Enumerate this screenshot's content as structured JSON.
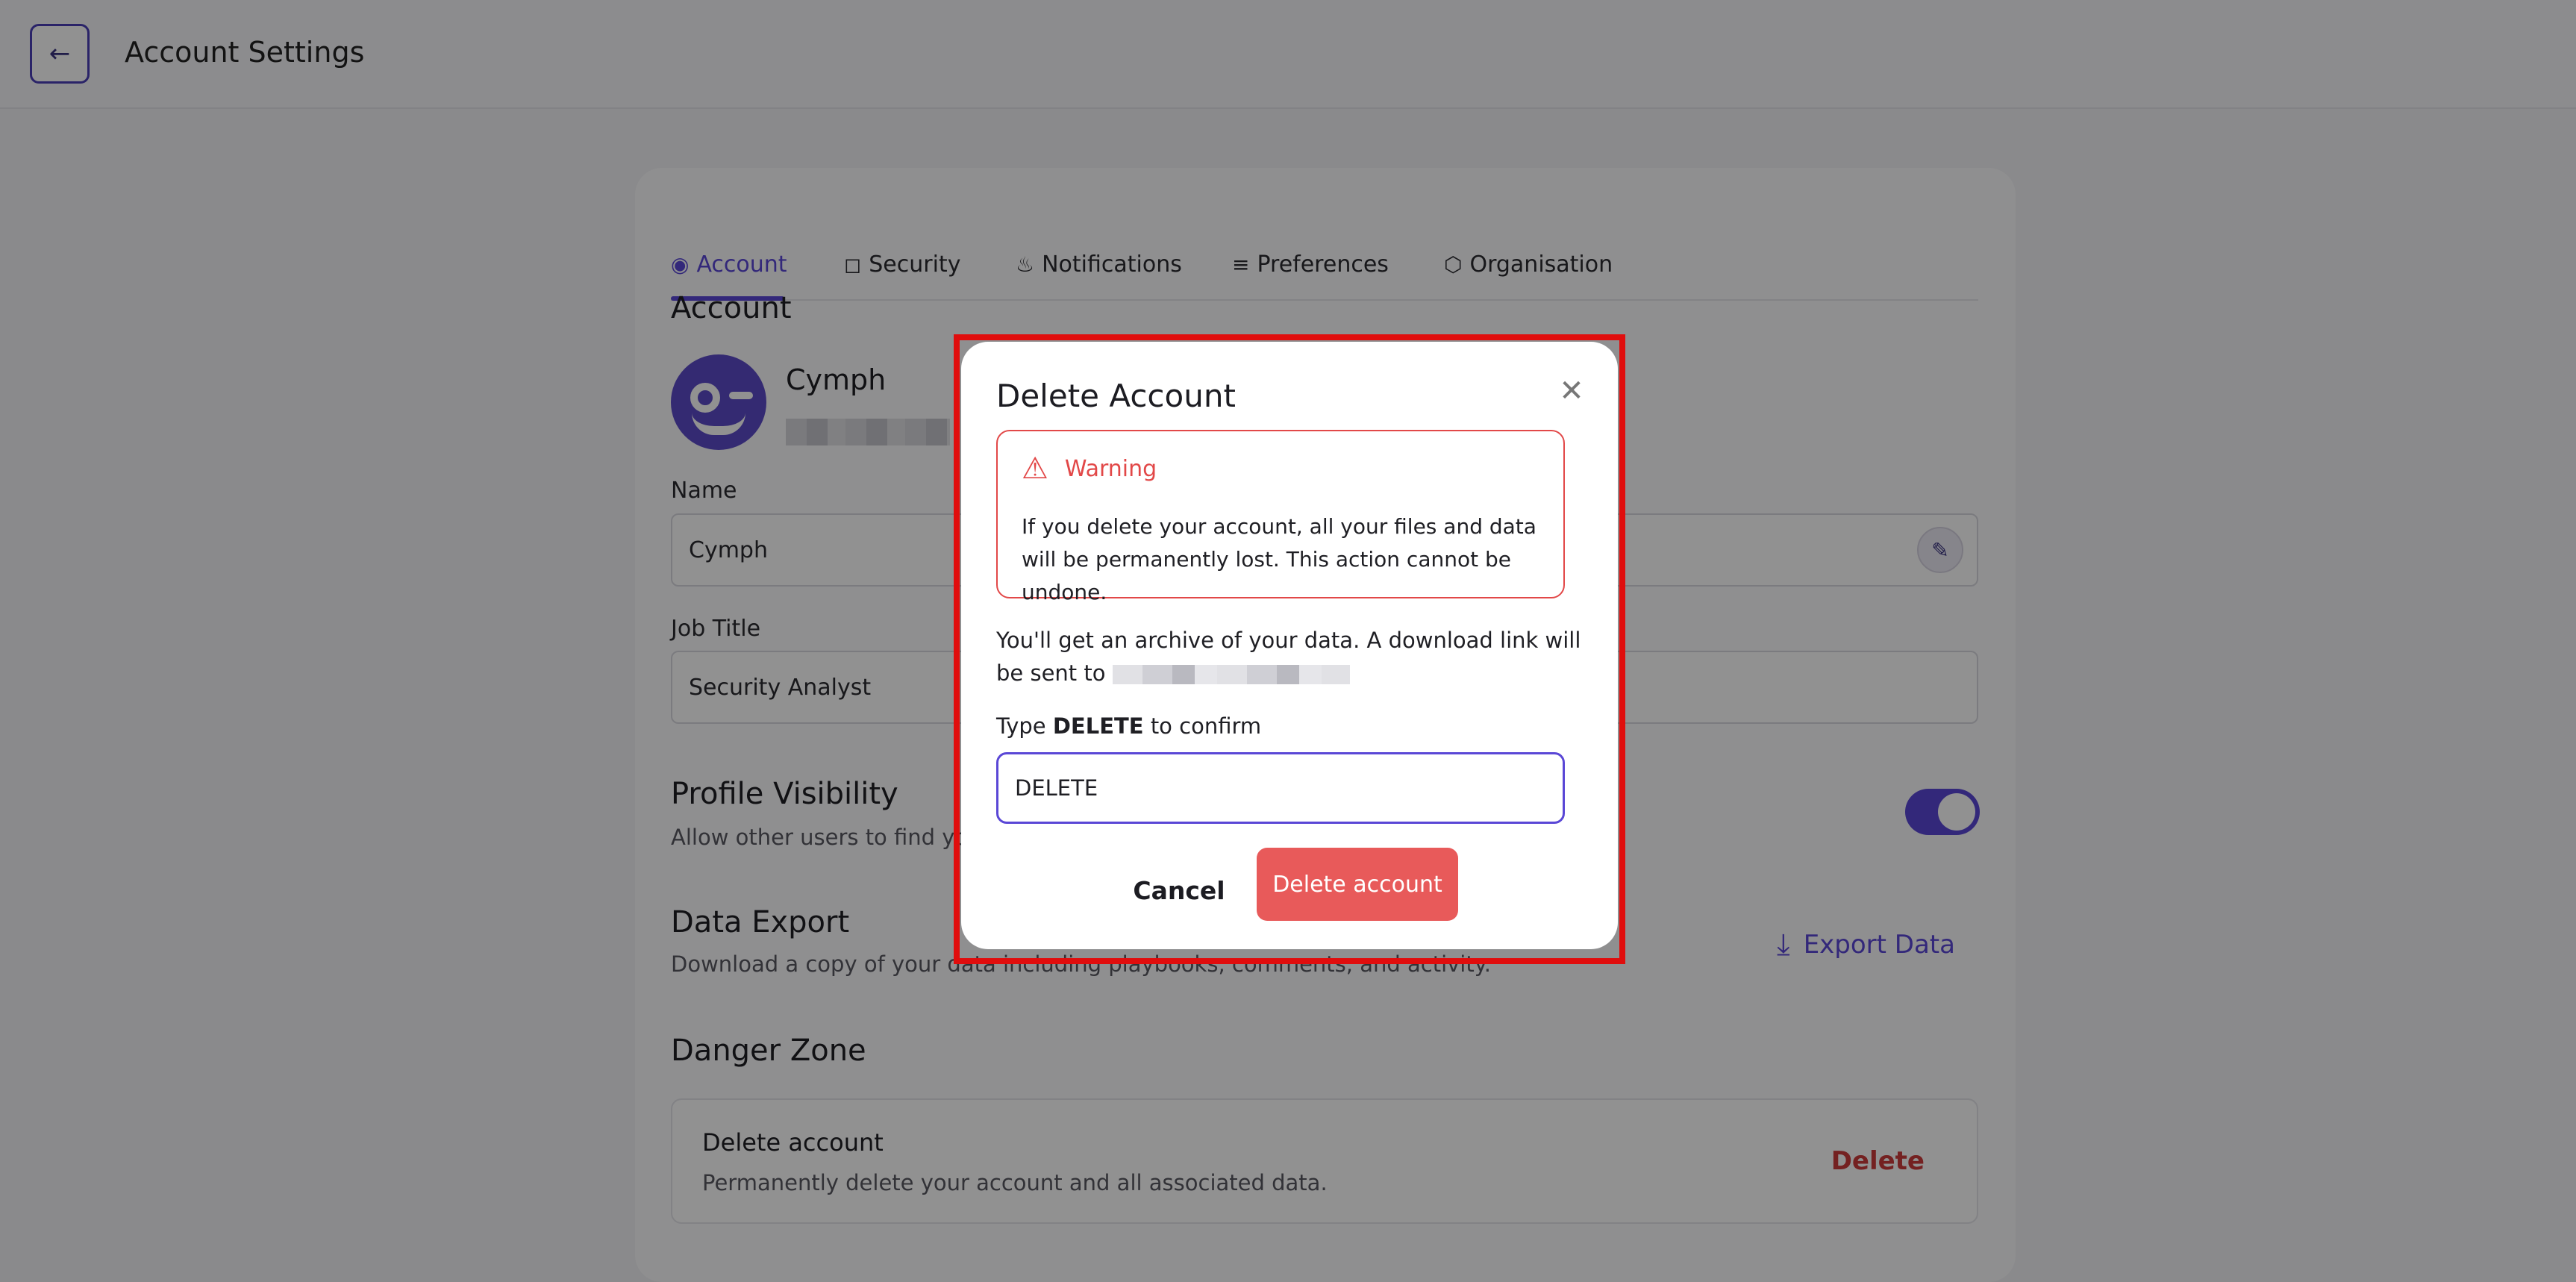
{
  "header": {
    "back_icon": "arrow-left-icon",
    "title": "Account Settings"
  },
  "tabs": [
    {
      "label": "Account",
      "icon": "user-circle-icon",
      "active": true
    },
    {
      "label": "Security",
      "icon": "shield-icon",
      "active": false
    },
    {
      "label": "Notifications",
      "icon": "bell-icon",
      "active": false
    },
    {
      "label": "Preferences",
      "icon": "sliders-icon",
      "active": false
    },
    {
      "label": "Organisation",
      "icon": "hexagon-icon",
      "active": false
    }
  ],
  "account": {
    "title": "Account",
    "profile_name": "Cymph",
    "name_label": "Name",
    "name_value": "Cymph",
    "job_label": "Job Title",
    "job_value": "Security Analyst"
  },
  "visibility": {
    "title": "Profile Visibility",
    "subtitle": "Allow other users to find you a",
    "enabled": true
  },
  "export": {
    "title": "Data Export",
    "subtitle": "Download a copy of your data including playbooks, comments, and activity.",
    "link": "Export Data"
  },
  "danger": {
    "title": "Danger Zone",
    "box_title": "Delete account",
    "box_subtitle": "Permanently delete your account and all associated data.",
    "link": "Delete"
  },
  "modal": {
    "title": "Delete Account",
    "warning_title": "Warning",
    "warning_text": "If you delete your account, all your files and data will be permanently lost. This action cannot be undone.",
    "archive_text": "You'll get an archive of your data. A download link will be sent to",
    "confirm_prefix": "Type",
    "confirm_keyword": "DELETE",
    "confirm_suffix": "to confirm",
    "input_value": "DELETE",
    "cancel_label": "Cancel",
    "delete_label": "Delete account"
  },
  "colors": {
    "accent": "#5a47d6",
    "danger": "#e85a5a",
    "highlight": "#e00d0d"
  }
}
